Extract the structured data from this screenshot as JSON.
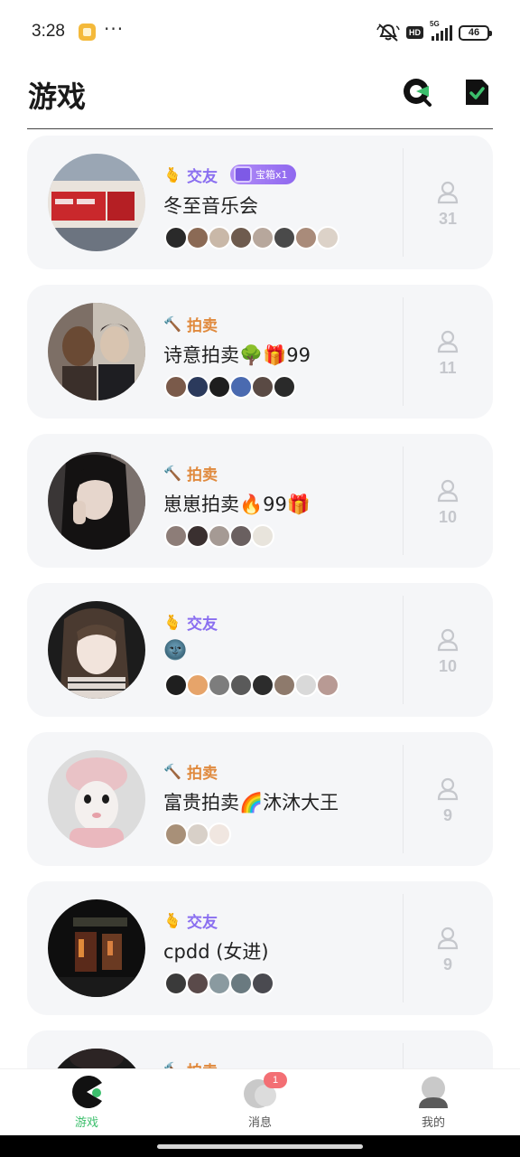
{
  "status_bar": {
    "time": "3:28",
    "dots": "···",
    "hd": "HD",
    "network": "5G",
    "battery": "46"
  },
  "header": {
    "title": "游戏"
  },
  "rooms": [
    {
      "tag_emoji": "🫰",
      "tag": "交友",
      "tag_type": "social",
      "badge": "宝箱x1",
      "title": "冬至音乐会",
      "count": "31",
      "members": [
        "#2a2a2a",
        "#8b6a55",
        "#c9b8a8",
        "#6e5b4e",
        "#b7a79c",
        "#4a4a4a",
        "#a98b7a",
        "#dcd2c8"
      ]
    },
    {
      "tag_emoji": "🔨",
      "tag": "拍卖",
      "tag_type": "auction",
      "badge": "",
      "title": "诗意拍卖🌳🎁99",
      "count": "11",
      "members": [
        "#7a5a4a",
        "#2b3a5c",
        "#1e1e1e",
        "#4a6ab0",
        "#5a4a44",
        "#2a2a2a"
      ]
    },
    {
      "tag_emoji": "🔨",
      "tag": "拍卖",
      "tag_type": "auction",
      "badge": "",
      "title": "崽崽拍卖🔥99🎁",
      "count": "10",
      "members": [
        "#8d7d78",
        "#3a3030",
        "#a59a94",
        "#6a6060",
        "#e8e4dc"
      ]
    },
    {
      "tag_emoji": "🫰",
      "tag": "交友",
      "tag_type": "social",
      "badge": "",
      "title": "🌚",
      "count": "10",
      "members": [
        "#1f1f1f",
        "#e6a46a",
        "#7d7d7d",
        "#5a5a5a",
        "#2c2c2c",
        "#8e7a6c",
        "#d9d9d9",
        "#b89a94"
      ]
    },
    {
      "tag_emoji": "🔨",
      "tag": "拍卖",
      "tag_type": "auction",
      "badge": "",
      "title": "富贵拍卖🌈沐沐大王",
      "count": "9",
      "members": [
        "#a89078",
        "#d8d0c8",
        "#f0e6e0"
      ]
    },
    {
      "tag_emoji": "🫰",
      "tag": "交友",
      "tag_type": "social",
      "badge": "",
      "title": "cpdd (女进)",
      "count": "9",
      "members": [
        "#3a3a3a",
        "#5a4a4a",
        "#8a9aa0",
        "#6a7a80",
        "#4a4a50"
      ]
    },
    {
      "tag_emoji": "🔨",
      "tag": "拍卖",
      "tag_type": "auction",
      "badge": "",
      "title": "",
      "count": "",
      "members": []
    }
  ],
  "tabs": [
    {
      "label": "游戏",
      "icon": "game-pacman-icon",
      "active": true
    },
    {
      "label": "消息",
      "icon": "message-icon",
      "badge": "1",
      "active": false
    },
    {
      "label": "我的",
      "icon": "profile-icon",
      "active": false
    }
  ],
  "colors": {
    "accent_green": "#3cbf6c",
    "social_tag": "#8a6ff0",
    "auction_tag": "#e08a3e",
    "badge_red": "#f36f74",
    "card_bg": "#f5f6f8"
  }
}
